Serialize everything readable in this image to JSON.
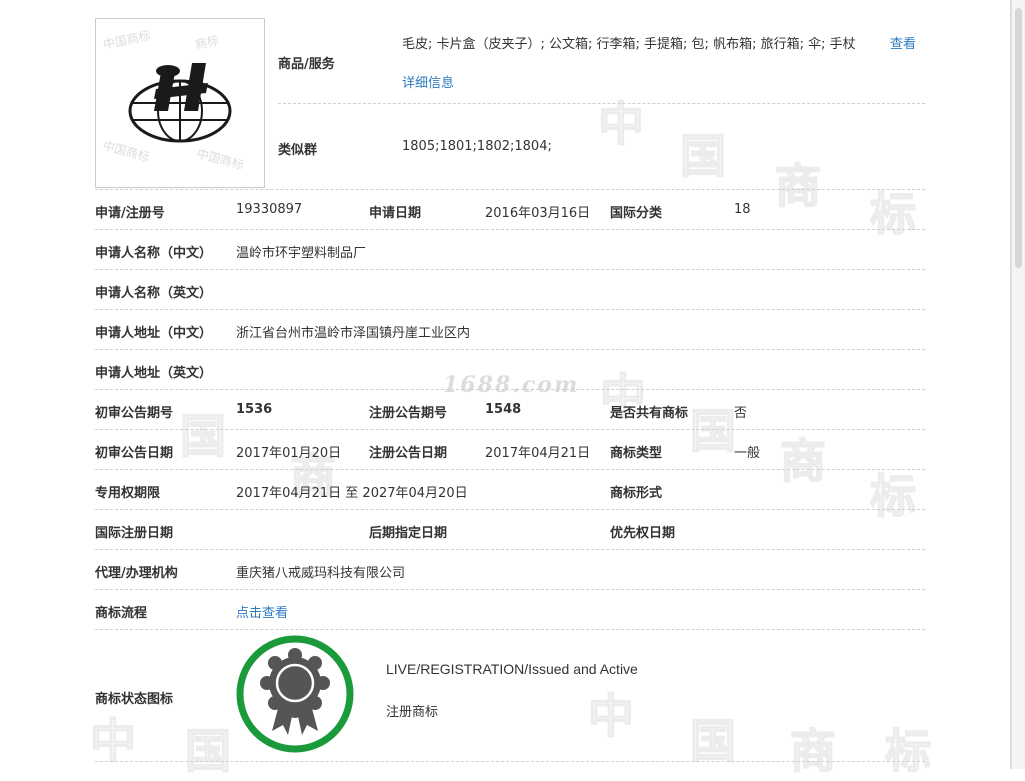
{
  "site_watermark": "1688.com",
  "watermark_chars": [
    "中",
    "国",
    "商",
    "标"
  ],
  "goods": {
    "label": "商品/服务",
    "items": "毛皮; 卡片盒（皮夹子）; 公文箱; 行李箱; 手提箱; 包; 帆布箱; 旅行箱; 伞; 手杖",
    "view_link": "查看",
    "detail_link": "详细信息"
  },
  "similar_group": {
    "label": "类似群",
    "value": "1805;1801;1802;1804;"
  },
  "registration": {
    "reg_no_label": "申请/注册号",
    "reg_no": "19330897",
    "apply_date_label": "申请日期",
    "apply_date": "2016年03月16日",
    "intl_class_label": "国际分类",
    "intl_class": "18"
  },
  "applicant": {
    "name_cn_label": "申请人名称（中文）",
    "name_cn": "温岭市环宇塑料制品厂",
    "name_en_label": "申请人名称（英文）",
    "name_en": "",
    "addr_cn_label": "申请人地址（中文）",
    "addr_cn": "浙江省台州市温岭市泽国镇丹崖工业区内",
    "addr_en_label": "申请人地址（英文）",
    "addr_en": ""
  },
  "announcement": {
    "prelim_no_label": "初审公告期号",
    "prelim_no": "1536",
    "reg_no_label": "注册公告期号",
    "reg_no": "1548",
    "shared_label": "是否共有商标",
    "shared": "否",
    "prelim_date_label": "初审公告日期",
    "prelim_date": "2017年01月20日",
    "reg_date_label": "注册公告日期",
    "reg_date": "2017年04月21日",
    "type_label": "商标类型",
    "type": "一般"
  },
  "rights": {
    "period_label": "专用权期限",
    "period": "2017年04月21日 至 2027年04月20日",
    "form_label": "商标形式",
    "form": "",
    "intl_reg_date_label": "国际注册日期",
    "intl_reg_date": "",
    "later_designation_label": "后期指定日期",
    "later_designation": "",
    "priority_date_label": "优先权日期",
    "priority_date": ""
  },
  "agent": {
    "label": "代理/办理机构",
    "value": "重庆猪八戒威玛科技有限公司"
  },
  "process": {
    "label": "商标流程",
    "link": "点击查看"
  },
  "status": {
    "label": "商标状态图标",
    "status_en": "LIVE/REGISTRATION/Issued and Active",
    "status_cn": "注册商标",
    "ring_color": "#1a9a3a",
    "medal_color": "#555555"
  }
}
